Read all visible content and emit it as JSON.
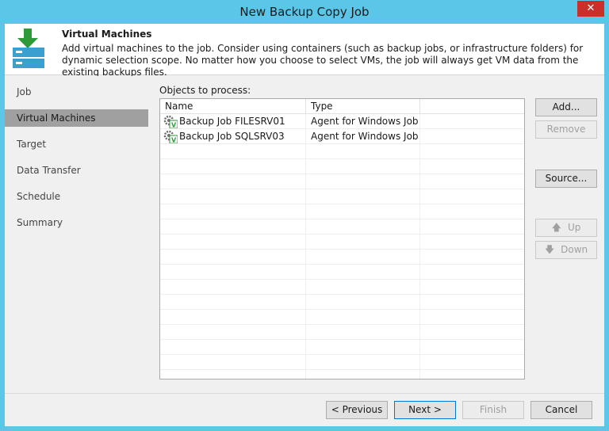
{
  "window": {
    "title": "New Backup Copy Job",
    "close_glyph": "✕"
  },
  "header": {
    "title": "Virtual Machines",
    "description": "Add virtual machines to the job. Consider using containers (such as backup jobs, or infrastructure folders) for dynamic selection scope. No matter how you choose to select VMs, the job will always get VM data from the existing backups files.",
    "icon": "backup-copy-download-icon"
  },
  "sidebar": {
    "items": [
      {
        "label": "Job"
      },
      {
        "label": "Virtual Machines"
      },
      {
        "label": "Target"
      },
      {
        "label": "Data Transfer"
      },
      {
        "label": "Schedule"
      },
      {
        "label": "Summary"
      }
    ],
    "active_index": 1
  },
  "objects": {
    "label": "Objects to process:",
    "columns": [
      "Name",
      "Type"
    ],
    "rows": [
      {
        "name": "Backup Job FILESRV01",
        "type": "Agent for Windows Job",
        "icon": "agent-job-icon"
      },
      {
        "name": "Backup Job SQLSRV03",
        "type": "Agent for Windows Job",
        "icon": "agent-job-icon"
      }
    ]
  },
  "side_buttons": {
    "add": "Add...",
    "remove": "Remove",
    "source": "Source...",
    "up": "Up",
    "down": "Down",
    "up_glyph": "🡅",
    "down_glyph": "🡇"
  },
  "footer": {
    "previous": "< Previous",
    "next": "Next >",
    "finish": "Finish",
    "cancel": "Cancel"
  },
  "colors": {
    "titlebar": "#5bc6e8",
    "close": "#c9302c",
    "active_nav": "#a0a0a0",
    "accent_green": "#2e9a3a"
  }
}
